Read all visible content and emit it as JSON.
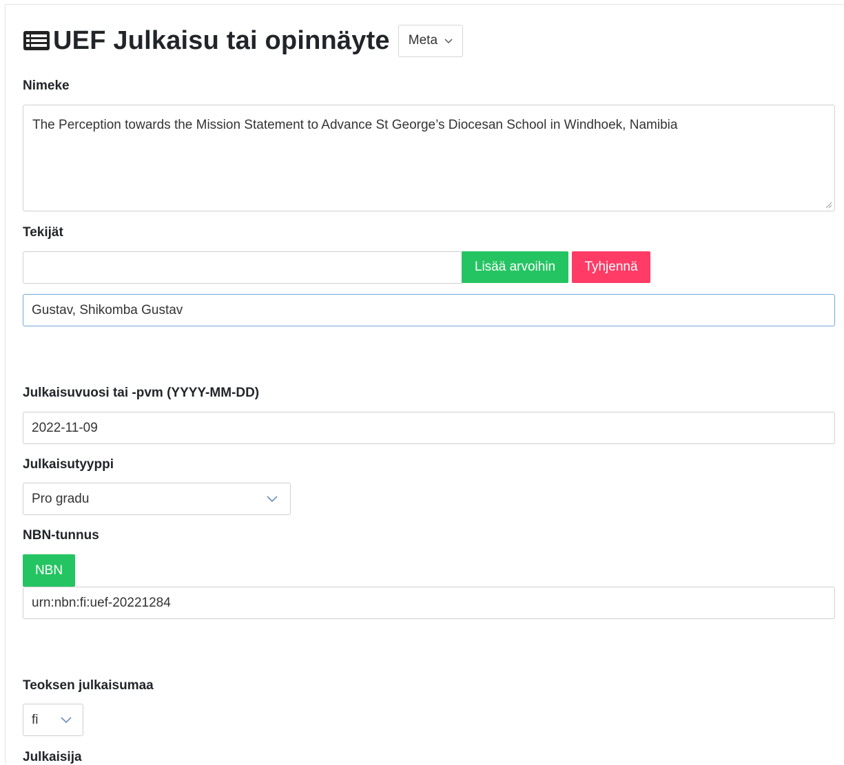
{
  "header": {
    "title": "UEF Julkaisu tai opinnäyte",
    "meta_button": "Meta"
  },
  "fields": {
    "nimeke": {
      "label": "Nimeke",
      "value": "The Perception towards the Mission Statement to Advance St George’s Diocesan School in Windhoek, Namibia"
    },
    "tekijat": {
      "label": "Tekijät",
      "input_value": "",
      "add_button": "Lisää arvoihin",
      "clear_button": "Tyhjennä",
      "values": "Gustav, Shikomba Gustav"
    },
    "julkaisuvuosi": {
      "label": "Julkaisuvuosi tai -pvm (YYYY-MM-DD)",
      "value": "2022-11-09"
    },
    "julkaisutyyppi": {
      "label": "Julkaisutyyppi",
      "selected": "Pro gradu"
    },
    "nbn": {
      "label": "NBN-tunnus",
      "button": "NBN",
      "value": "urn:nbn:fi:uef-20221284"
    },
    "julkaisumaa": {
      "label": "Teoksen julkaisumaa",
      "selected": "fi"
    },
    "julkaisija": {
      "label": "Julkaisija"
    }
  },
  "colors": {
    "green": "#25c462",
    "red": "#ff3b66",
    "focus_border": "#6fa8d8"
  }
}
